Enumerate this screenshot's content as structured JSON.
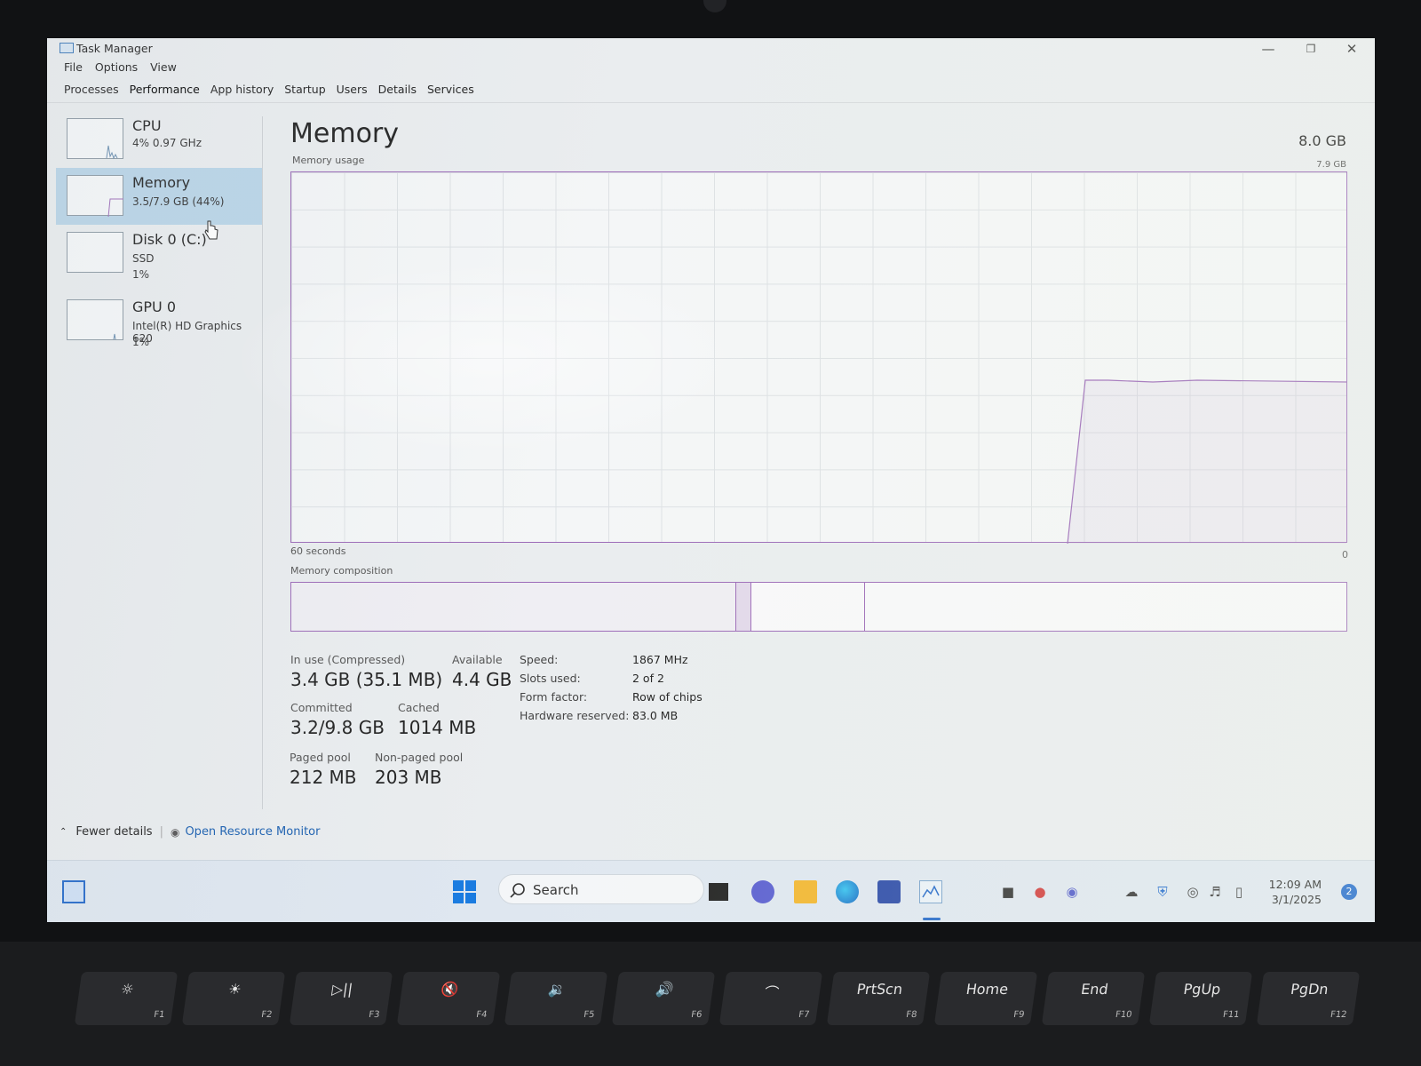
{
  "window": {
    "title": "Task Manager",
    "minimize": "—",
    "restore": "❐",
    "close": "✕"
  },
  "menu": [
    "File",
    "Options",
    "View"
  ],
  "tabs": [
    "Processes",
    "Performance",
    "App history",
    "Startup",
    "Users",
    "Details",
    "Services"
  ],
  "active_tab": "Performance",
  "sidebar": {
    "items": [
      {
        "name": "CPU",
        "line1": "4% 0.97 GHz",
        "line2": ""
      },
      {
        "name": "Memory",
        "line1": "3.5/7.9 GB (44%)",
        "line2": "",
        "selected": true
      },
      {
        "name": "Disk 0 (C:)",
        "line1": "SSD",
        "line2": "1%"
      },
      {
        "name": "GPU 0",
        "line1": "Intel(R) HD Graphics 620",
        "line2": "1%"
      }
    ]
  },
  "main": {
    "title": "Memory",
    "total": "8.0 GB",
    "usage_label": "Memory usage",
    "usage_max": "7.9 GB",
    "time_left": "60 seconds",
    "time_right": "0",
    "composition_label": "Memory composition",
    "stats": {
      "in_use_label": "In use (Compressed)",
      "in_use": "3.4 GB (35.1 MB)",
      "available_label": "Available",
      "available": "4.4 GB",
      "committed_label": "Committed",
      "committed": "3.2/9.8 GB",
      "cached_label": "Cached",
      "cached": "1014 MB",
      "paged_label": "Paged pool",
      "paged": "212 MB",
      "nonpaged_label": "Non-paged pool",
      "nonpaged": "203 MB"
    },
    "specs": [
      {
        "k": "Speed:",
        "v": "1867 MHz"
      },
      {
        "k": "Slots used:",
        "v": "2 of 2"
      },
      {
        "k": "Form factor:",
        "v": "Row of chips"
      },
      {
        "k": "Hardware reserved:",
        "v": "83.0 MB"
      }
    ]
  },
  "footer": {
    "fewer": "Fewer details",
    "monitor": "Open Resource Monitor"
  },
  "taskbar": {
    "search": "Search",
    "time": "12:09 AM",
    "date": "3/1/2025",
    "notifications": "2"
  },
  "colors": {
    "accent": "#9c6ab8",
    "selected": "#b9d5e8",
    "link": "#1a5fb0"
  },
  "keys": [
    {
      "main": "☼",
      "fn": "F1"
    },
    {
      "main": "☀",
      "fn": "F2"
    },
    {
      "main": "▷||",
      "fn": "F3"
    },
    {
      "main": "🔇",
      "fn": "F4"
    },
    {
      "main": "🔉",
      "fn": "F5"
    },
    {
      "main": "🔊",
      "fn": "F6"
    },
    {
      "main": "⌒",
      "fn": "F7"
    },
    {
      "main": "PrtScn",
      "fn": "F8"
    },
    {
      "main": "Home",
      "fn": "F9"
    },
    {
      "main": "End",
      "fn": "F10"
    },
    {
      "main": "PgUp",
      "fn": "F11"
    },
    {
      "main": "PgDn",
      "fn": "F12"
    }
  ]
}
